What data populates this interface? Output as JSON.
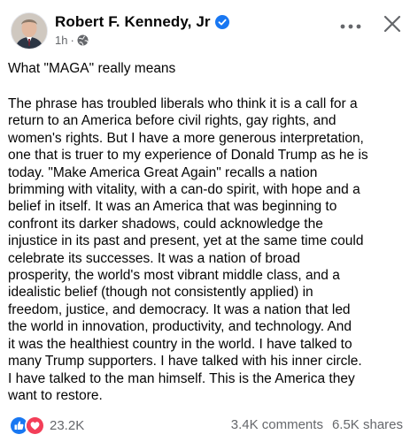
{
  "post": {
    "author": {
      "name": "Robert F. Kennedy, Jr",
      "verified": true,
      "avatar_icon": "profile-photo"
    },
    "meta": {
      "time": "1h",
      "separator": "·",
      "audience_icon": "globe-icon"
    },
    "actions": {
      "more_icon": "more-dots-icon",
      "close_icon": "close-icon"
    },
    "title": "What \"MAGA\" really means",
    "body_lines": [
      "The phrase has troubled liberals who think it is a call for a",
      "return to an America before civil rights, gay rights, and",
      "women's rights. But I have a more generous interpretation,",
      "one that is truer to my experience of Donald Trump as he is",
      "today. \"Make America Great Again\" recalls a nation",
      "brimming with vitality, with a can-do spirit, with hope and a",
      "belief in itself. It was an America that was beginning to",
      "confront its darker shadows, could acknowledge the",
      "injustice in its past and present, yet at the same time could",
      "celebrate its successes. It was a nation of broad",
      "prosperity, the world's most vibrant middle class, and a",
      "idealistic belief (though not consistently applied) in",
      "freedom, justice, and democracy. It was a nation that led",
      "the world in innovation, productivity, and technology. And",
      "it was the healthiest country in the world. I have talked to",
      "many Trump supporters. I have talked with his inner circle.",
      "I have talked to the man himself. This is the America they",
      "want to restore."
    ]
  },
  "footer": {
    "reactions": [
      "like-icon",
      "love-icon"
    ],
    "reaction_count": "23.2K",
    "comments": "3.4K comments",
    "shares": "6.5K shares"
  },
  "colors": {
    "text_primary": "#050505",
    "text_secondary": "#65676b",
    "facebook_blue": "#1877f2",
    "love_red": "#f33e58"
  }
}
